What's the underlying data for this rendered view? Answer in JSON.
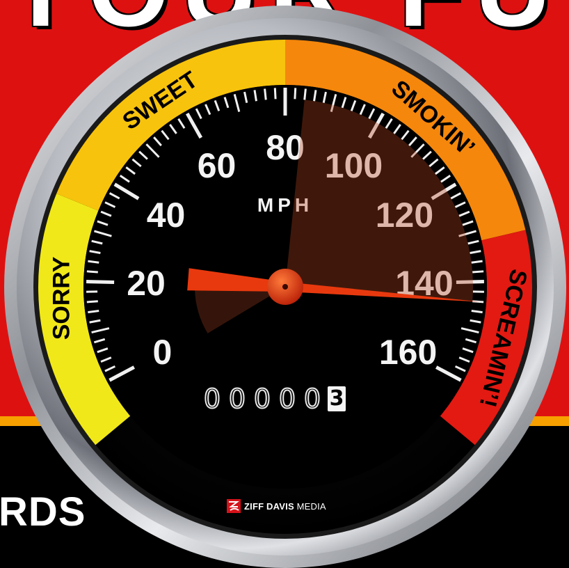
{
  "cover": {
    "title_fragment": "YOUR FU",
    "bottom_fragment": "RDS",
    "brand": {
      "bold": "ZIFF DAVIS",
      "light": "MEDIA"
    }
  },
  "gauge": {
    "unit": "MPH",
    "tick_labels": [
      "0",
      "20",
      "40",
      "60",
      "80",
      "100",
      "120",
      "140",
      "160"
    ],
    "zones": [
      {
        "label": "SORRY",
        "color": "#f1e81a"
      },
      {
        "label": "SWEET",
        "color": "#f8c30c"
      },
      {
        "label": "SMOKIN’",
        "color": "#f5870c"
      },
      {
        "label": "SCREAMIN’!",
        "color": "#e21a12"
      }
    ],
    "needle_speed": 144,
    "needle_color": "#e8390e",
    "odometer": {
      "digits": [
        "0",
        "0",
        "0",
        "0",
        "0"
      ],
      "last_digit": "3"
    }
  }
}
